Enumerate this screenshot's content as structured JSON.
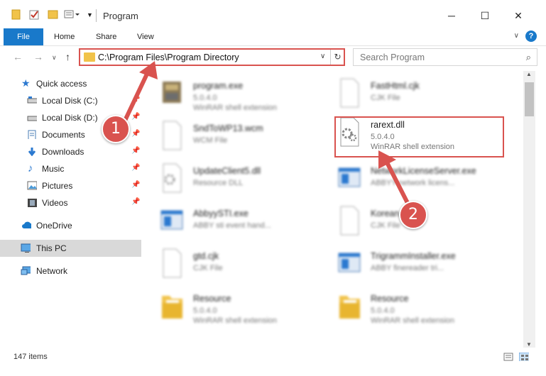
{
  "window": {
    "title": "Program",
    "minimize_glyph": "─",
    "maximize_glyph": "☐",
    "close_glyph": "✕"
  },
  "ribbon": {
    "tabs": [
      "File",
      "Home",
      "Share",
      "View"
    ],
    "help": "?",
    "collapse": "∨"
  },
  "nav": {
    "back": "←",
    "forward": "→",
    "dropdown": "∨",
    "up": "↑"
  },
  "address": {
    "path": "C:\\Program Files\\Program Directory",
    "chevron": "∨",
    "refresh": "↻"
  },
  "search": {
    "placeholder": "Search Program",
    "icon": "⌕"
  },
  "sidebar": {
    "items": [
      {
        "label": "Quick access",
        "icon": "star-icon"
      },
      {
        "label": "Local Disk (C:)",
        "icon": "drive-icon"
      },
      {
        "label": "Local Disk (D:)",
        "icon": "drive-icon"
      },
      {
        "label": "Documents",
        "icon": "documents-icon"
      },
      {
        "label": "Downloads",
        "icon": "download-icon"
      },
      {
        "label": "Music",
        "icon": "music-icon"
      },
      {
        "label": "Pictures",
        "icon": "pictures-icon"
      },
      {
        "label": "Videos",
        "icon": "videos-icon"
      },
      {
        "label": "OneDrive",
        "icon": "cloud-icon"
      },
      {
        "label": "This PC",
        "icon": "pc-icon"
      },
      {
        "label": "Network",
        "icon": "network-icon"
      }
    ],
    "pin": "📌"
  },
  "files": [
    {
      "name": "program.exe",
      "line2": "5.0.4.0",
      "line3": "WinRAR shell extension",
      "icon": "exe-icon"
    },
    {
      "name": "FastHtml.cjk",
      "line2": "CJK File",
      "line3": "",
      "icon": "blank-file-icon"
    },
    {
      "name": "SndToWP13.wcm",
      "line2": "WCM File",
      "line3": "",
      "icon": "blank-file-icon"
    },
    {
      "name": "rarext.dll",
      "line2": "5.0.4.0",
      "line3": "WinRAR shell extension",
      "icon": "dll-gear-icon"
    },
    {
      "name": "UpdateClient5.dll",
      "line2": "Resource DLL",
      "line3": "",
      "icon": "dll-gear-icon"
    },
    {
      "name": "NetworkLicenseServer.exe",
      "line2": "ABBYY network licens...",
      "line3": "",
      "icon": "app-window-icon"
    },
    {
      "name": "AbbyySTI.exe",
      "line2": "ABBY sti event hand...",
      "line3": "",
      "icon": "app-window-icon"
    },
    {
      "name": "Korean.cjk",
      "line2": "CJK File",
      "line3": "",
      "icon": "blank-file-icon"
    },
    {
      "name": "gtd.cjk",
      "line2": "CJK File",
      "line3": "",
      "icon": "blank-file-icon"
    },
    {
      "name": "TrigrammInstaller.exe",
      "line2": "ABBY finereader tri...",
      "line3": "",
      "icon": "app-window-icon"
    },
    {
      "name": "Resource",
      "line2": "5.0.4.0",
      "line3": "WinRAR shell extension",
      "icon": "folder-file-icon"
    },
    {
      "name": "Resource",
      "line2": "5.0.4.0",
      "line3": "WinRAR shell extension",
      "icon": "folder-file-icon"
    }
  ],
  "status": {
    "count": "147 items"
  },
  "annotations": {
    "step1": "1",
    "step2": "2"
  },
  "colors": {
    "accent": "#1979ca",
    "annotation": "#d9534f",
    "folder": "#f1c34a"
  }
}
